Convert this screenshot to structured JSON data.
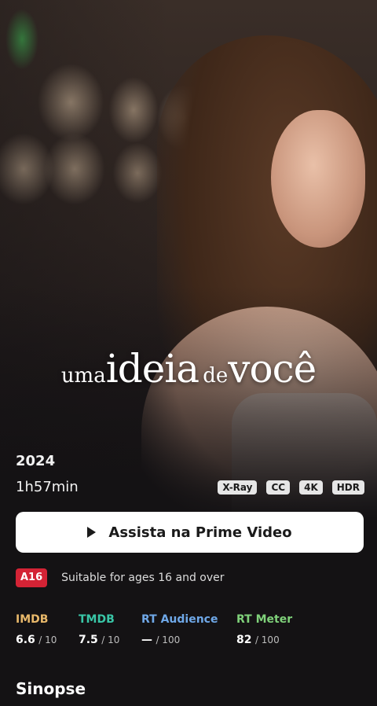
{
  "hero": {
    "title_parts": [
      "uma",
      "ideia",
      "de",
      "você"
    ]
  },
  "details": {
    "year": "2024",
    "runtime": "1h57min",
    "badges": [
      "X-Ray",
      "CC",
      "4K",
      "HDR"
    ]
  },
  "actions": {
    "watch_label": "Assista na Prime Video"
  },
  "rating": {
    "badge": "A16",
    "badge_color": "#d42335",
    "description": "Suitable for ages 16 and over"
  },
  "scores": [
    {
      "label": "IMDB",
      "color": "#e8b86a",
      "value": "6.6",
      "scale": "/ 10"
    },
    {
      "label": "TMDB",
      "color": "#39c6a7",
      "value": "7.5",
      "scale": "/ 10"
    },
    {
      "label": "RT Audience",
      "color": "#6fa8e8",
      "value": "—",
      "scale": "/ 100"
    },
    {
      "label": "RT Meter",
      "color": "#7fd17a",
      "value": "82",
      "scale": "/ 100"
    }
  ],
  "sections": {
    "synopsis_heading": "Sinopse"
  }
}
